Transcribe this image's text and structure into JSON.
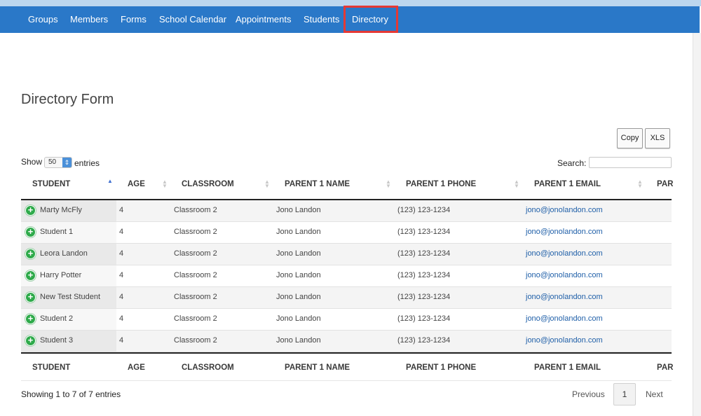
{
  "nav": {
    "items": [
      "Groups",
      "Members",
      "Forms",
      "School Calendar",
      "Appointments",
      "Students",
      "Directory"
    ],
    "active": "Directory"
  },
  "page": {
    "title": "Directory Form"
  },
  "toolbar": {
    "copy_label": "Copy",
    "xls_label": "XLS"
  },
  "length": {
    "show_label": "Show",
    "value": "50",
    "entries_label": "entries"
  },
  "search": {
    "label": "Search:",
    "value": ""
  },
  "table": {
    "columns": [
      "STUDENT",
      "AGE",
      "CLASSROOM",
      "PARENT 1 NAME",
      "PARENT 1 PHONE",
      "PARENT 1 EMAIL",
      "PAR"
    ],
    "sorted_column": "STUDENT",
    "sort_direction": "ascending",
    "rows": [
      {
        "student": "Marty McFly",
        "age": "4",
        "classroom": "Classroom 2",
        "parent_name": "Jono Landon",
        "parent_phone": "(123) 123-1234",
        "parent_email": "jono@jonolandon.com"
      },
      {
        "student": "Student 1",
        "age": "4",
        "classroom": "Classroom 2",
        "parent_name": "Jono Landon",
        "parent_phone": "(123) 123-1234",
        "parent_email": "jono@jonolandon.com"
      },
      {
        "student": "Leora Landon",
        "age": "4",
        "classroom": "Classroom 2",
        "parent_name": "Jono Landon",
        "parent_phone": "(123) 123-1234",
        "parent_email": "jono@jonolandon.com"
      },
      {
        "student": "Harry Potter",
        "age": "4",
        "classroom": "Classroom 2",
        "parent_name": "Jono Landon",
        "parent_phone": "(123) 123-1234",
        "parent_email": "jono@jonolandon.com"
      },
      {
        "student": "New Test Student",
        "age": "4",
        "classroom": "Classroom 2",
        "parent_name": "Jono Landon",
        "parent_phone": "(123) 123-1234",
        "parent_email": "jono@jonolandon.com"
      },
      {
        "student": "Student 2",
        "age": "4",
        "classroom": "Classroom 2",
        "parent_name": "Jono Landon",
        "parent_phone": "(123) 123-1234",
        "parent_email": "jono@jonolandon.com"
      },
      {
        "student": "Student 3",
        "age": "4",
        "classroom": "Classroom 2",
        "parent_name": "Jono Landon",
        "parent_phone": "(123) 123-1234",
        "parent_email": "jono@jonolandon.com"
      }
    ],
    "expand_icon": "plus-circle-icon"
  },
  "footer": {
    "info": "Showing 1 to 7 of 7 entries",
    "previous_label": "Previous",
    "current_page": "1",
    "next_label": "Next"
  },
  "colors": {
    "navbar": "#2a78c8",
    "highlight": "#e53935",
    "expand": "#2eaa4a",
    "link": "#1f5fa8"
  }
}
